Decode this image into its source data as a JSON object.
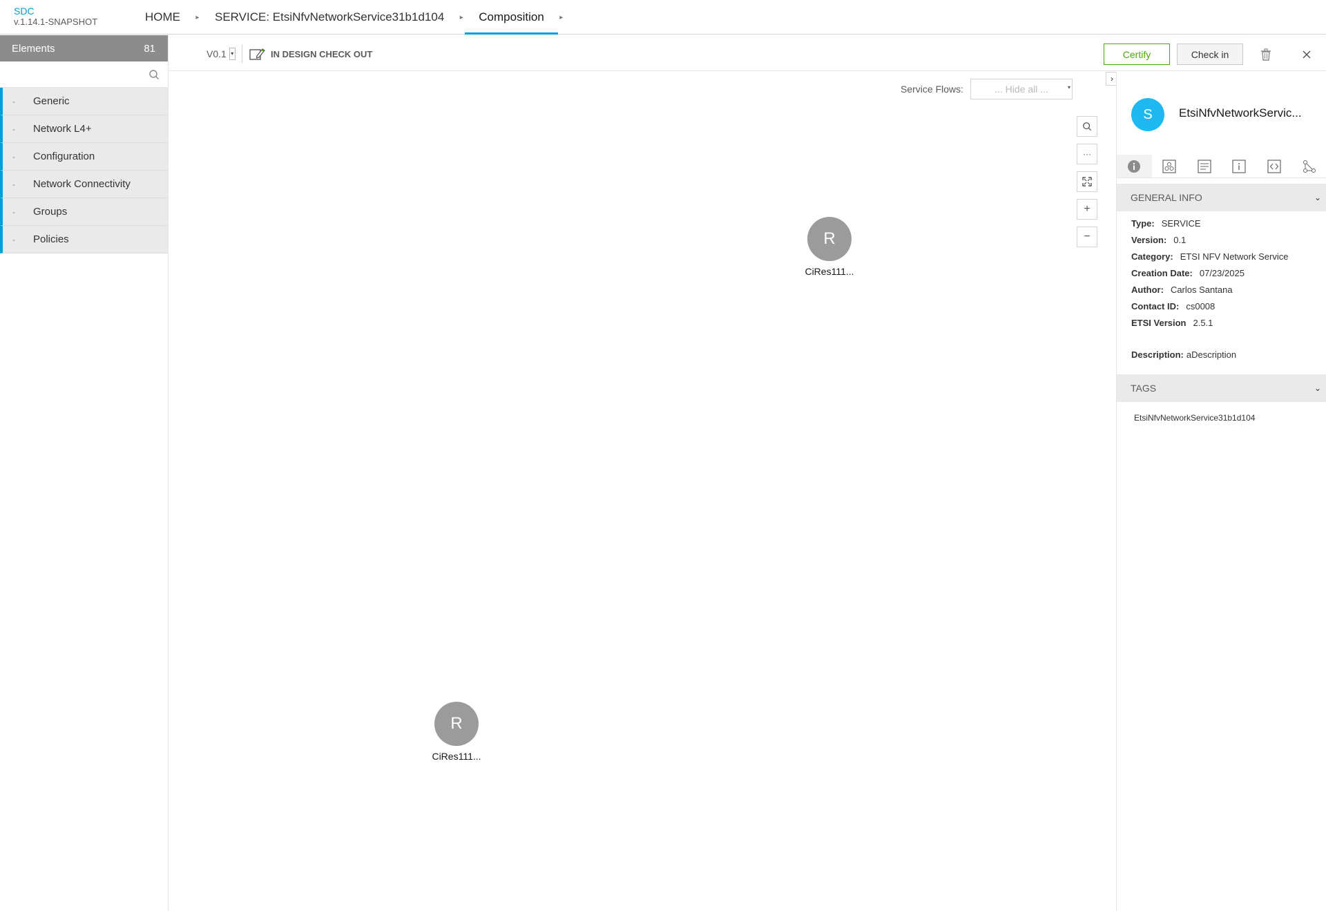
{
  "brand": {
    "name": "SDC",
    "version": "v.1.14.1-SNAPSHOT"
  },
  "breadcrumbs": [
    {
      "label": "HOME"
    },
    {
      "label": "SERVICE: EtsiNfvNetworkService31b1d104"
    },
    {
      "label": "Composition"
    }
  ],
  "palette": {
    "title": "Elements",
    "count": "81",
    "search_placeholder": "",
    "items": [
      {
        "label": "Generic"
      },
      {
        "label": "Network L4+"
      },
      {
        "label": "Configuration"
      },
      {
        "label": "Network Connectivity"
      },
      {
        "label": "Groups"
      },
      {
        "label": "Policies"
      }
    ]
  },
  "toolbar": {
    "version": "V0.1",
    "state": "IN DESIGN CHECK OUT",
    "certify_label": "Certify",
    "checkin_label": "Check in"
  },
  "canvas": {
    "flows_label": "Service Flows:",
    "flows_value": "... Hide all ...",
    "nodes": [
      {
        "initial": "R",
        "label": "CiRes111..."
      },
      {
        "initial": "R",
        "label": "CiRes111..."
      }
    ]
  },
  "panel": {
    "avatar": "S",
    "title": "EtsiNfvNetworkServic...",
    "general_info_title": "GENERAL INFO",
    "info": [
      {
        "key": "Type:",
        "value": "SERVICE"
      },
      {
        "key": "Version:",
        "value": "0.1"
      },
      {
        "key": "Category:",
        "value": "ETSI NFV Network Service"
      },
      {
        "key": "Creation Date:",
        "value": "07/23/2025"
      },
      {
        "key": "Author:",
        "value": "Carlos Santana"
      },
      {
        "key": "Contact ID:",
        "value": "cs0008"
      },
      {
        "key": "ETSI Version",
        "value": "2.5.1"
      }
    ],
    "description_key": "Description:",
    "description_value": "aDescription",
    "tags_title": "TAGS",
    "tags": [
      "EtsiNfvNetworkService31b1d104"
    ]
  },
  "colors": {
    "accent": "#009fdb",
    "certify": "#4ca90c",
    "node": "#9b9b9b",
    "avatar": "#1eb9f3"
  }
}
